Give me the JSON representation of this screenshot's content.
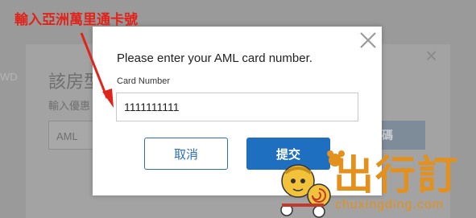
{
  "annotation": {
    "text": "輸入亞洲萬里通卡號"
  },
  "background": {
    "side_text": "WD",
    "dialog_title": "該房型",
    "dialog_sub": "輸入優惠",
    "input_value": "AML",
    "button_label": "代碼"
  },
  "modal": {
    "title": "Please enter your AML card number.",
    "field_label": "Card Number",
    "field_value": "1111111111",
    "cancel_label": "取消",
    "submit_label": "提交"
  },
  "watermark": {
    "name": "出行訂",
    "url": "chuxingding.com"
  },
  "colors": {
    "accent": "#1f6fc0",
    "annotation": "#e0241b",
    "watermark": "#e3901c"
  }
}
